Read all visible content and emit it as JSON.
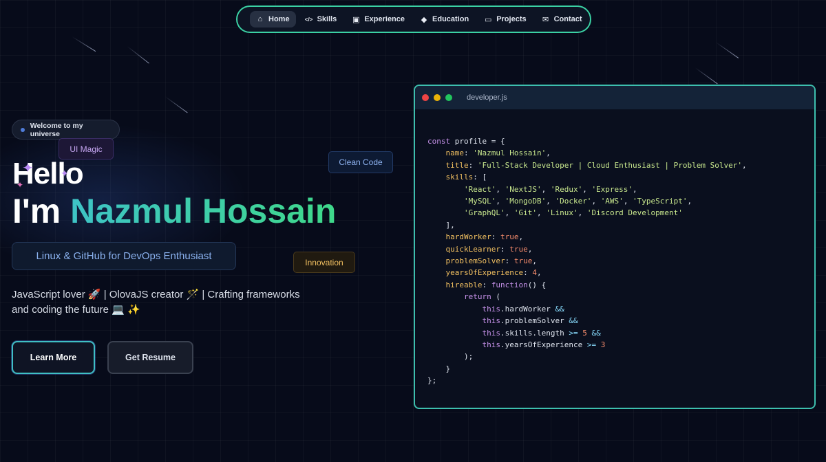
{
  "nav": {
    "items": [
      {
        "label": "Home",
        "icon": "home-icon",
        "active": true
      },
      {
        "label": "Skills",
        "icon": "code-icon",
        "active": false
      },
      {
        "label": "Experience",
        "icon": "briefcase-icon",
        "active": false
      },
      {
        "label": "Education",
        "icon": "graduation-cap-icon",
        "active": false
      },
      {
        "label": "Projects",
        "icon": "monitor-icon",
        "active": false
      },
      {
        "label": "Contact",
        "icon": "envelope-icon",
        "active": false
      }
    ]
  },
  "hero": {
    "welcome_badge": "Welcome to my universe",
    "tag_ui": "UI Magic",
    "tag_clean": "Clean Code",
    "tag_innovation": "Innovation",
    "hello": "Hello",
    "im": "I'm",
    "name": "Nazmul Hossain",
    "subtitle": "Linux & GitHub for DevOps Enthusiast",
    "description_line1": "JavaScript lover 🚀 | OlovaJS creator 🪄 | Crafting frameworks",
    "description_line2": "and coding the future 💻 ✨",
    "learn_more": "Learn More",
    "get_resume": "Get Resume"
  },
  "code_window": {
    "filename": "developer.js",
    "colors": {
      "close": "#ef4444",
      "minimize": "#eab308",
      "maximize": "#22c55e"
    },
    "lines": [
      "const profile = {",
      "    name: 'Nazmul Hossain',",
      "    title: 'Full-Stack Developer | Cloud Enthusiast | Problem Solver',",
      "    skills: [",
      "        'React', 'NextJS', 'Redux', 'Express',",
      "        'MySQL', 'MongoDB', 'Docker', 'AWS', 'TypeScript',",
      "        'GraphQL', 'Git', 'Linux', 'Discord Development'",
      "    ],",
      "    hardWorker: true,",
      "    quickLearner: true,",
      "    problemSolver: true,",
      "    yearsOfExperience: 4,",
      "    hireable: function() {",
      "        return (",
      "            this.hardWorker &&",
      "            this.problemSolver &&",
      "            this.skills.length >= 5 &&",
      "            this.yearsOfExperience >= 3",
      "        );",
      "    }",
      "};"
    ]
  }
}
